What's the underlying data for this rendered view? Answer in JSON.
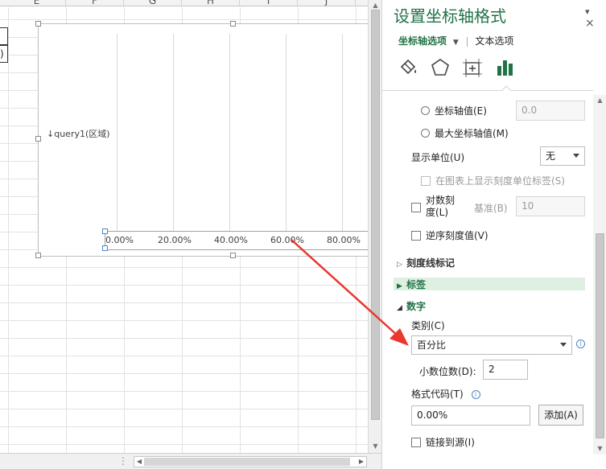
{
  "sheet": {
    "columns": [
      "E",
      "F",
      "G",
      "H",
      "I",
      "J"
    ],
    "left_cell_text": ")"
  },
  "chart": {
    "series_label": "↓query1(区域)",
    "tick_labels": [
      "0.00%",
      "20.00%",
      "40.00%",
      "60.00%",
      "80.00%"
    ]
  },
  "panel": {
    "title": "设置坐标轴格式",
    "tab_axis": "坐标轴选项",
    "tab_text": "文本选项",
    "icons": [
      "fill-line-icon",
      "effects-pentagon-icon",
      "size-properties-icon",
      "axis-options-bar-chart-icon"
    ],
    "axis_value_label": "坐标轴值(E)",
    "axis_value": "0.0",
    "max_axis_value_label": "最大坐标轴值(M)",
    "display_units_label": "显示单位(U)",
    "display_units_value": "无",
    "show_units_label": "在图表上显示刻度单位标签(S)",
    "log_scale_label_1": "对数刻",
    "log_scale_label_2": "度(L)",
    "base_label": "基准(B)",
    "base_value": "10",
    "reverse_order_label": "逆序刻度值(V)",
    "section_tick_marks": "刻度线标记",
    "section_labels": "标签",
    "section_number": "数字",
    "category_label": "类别(C)",
    "category_value": "百分比",
    "decimal_places_label": "小数位数(D):",
    "decimal_places_value": "2",
    "format_code_label": "格式代码(T)",
    "format_code_value": "0.00%",
    "add_button": "添加(A)",
    "link_source_label": "链接到源(I)",
    "info_glyph": "i",
    "close_glyph": "×",
    "pin_glyph": "▾"
  },
  "colors": {
    "accent": "#217346",
    "arrow": "#e8382f"
  }
}
